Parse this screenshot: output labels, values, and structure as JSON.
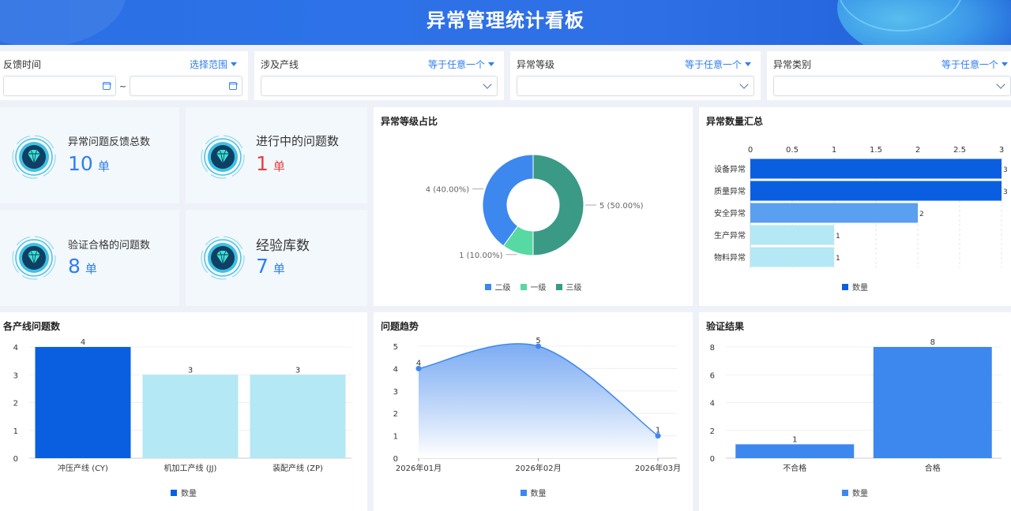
{
  "header": {
    "title": "异常管理统计看板"
  },
  "filters": {
    "feedback_time": {
      "label": "反馈时间",
      "op": "选择范围",
      "sep": "~"
    },
    "line": {
      "label": "涉及产线",
      "op": "等于任意一个"
    },
    "level": {
      "label": "异常等级",
      "op": "等于任意一个"
    },
    "category": {
      "label": "异常类别",
      "op": "等于任意一个"
    }
  },
  "kpis": [
    {
      "label": "异常问题反馈总数",
      "value": "10",
      "unit": "单"
    },
    {
      "label": "进行中的问题数",
      "value": "1",
      "unit": "单"
    },
    {
      "label": "验证合格的问题数",
      "value": "8",
      "unit": "单"
    },
    {
      "label": "经验库数",
      "value": "7",
      "unit": "单"
    }
  ],
  "colors": {
    "primary": "#2f7ef0",
    "red": "#e54141",
    "dark_blue": "#0a5fe0",
    "light_cyan": "#b3e8f4",
    "mid_blue": "#5a9ff0",
    "teal": "#3a9a86",
    "green": "#57d9a3",
    "blue": "#3d88ef"
  },
  "chart_data": [
    {
      "type": "pie",
      "title": "异常等级占比",
      "categories": [
        "二级",
        "一级",
        "三级"
      ],
      "values": [
        4,
        1,
        5
      ],
      "labels": [
        "4 (40.00%)",
        "1 (10.00%)",
        "5 (50.00%)"
      ],
      "colors": [
        "#3d88ef",
        "#57d9a3",
        "#3a9a86"
      ],
      "legend": "bottom"
    },
    {
      "type": "bar",
      "orientation": "horizontal",
      "title": "异常数量汇总",
      "categories": [
        "设备异常",
        "质量异常",
        "安全异常",
        "生产异常",
        "物料异常"
      ],
      "series": [
        {
          "name": "数量",
          "values": [
            3,
            3,
            2,
            1,
            1
          ]
        }
      ],
      "colors": [
        "#0a5fe0",
        "#0a5fe0",
        "#5a9ff0",
        "#b3e8f4",
        "#b3e8f4"
      ],
      "xlim": [
        0,
        3
      ],
      "xticks": [
        "0",
        "0.5",
        "1",
        "1.5",
        "2",
        "2.5",
        "3"
      ],
      "legend": "bottom"
    },
    {
      "type": "bar",
      "title": "各产线问题数",
      "categories": [
        "冲压产线 (CY)",
        "机加工产线 (JJ)",
        "装配产线 (ZP)"
      ],
      "series": [
        {
          "name": "数量",
          "values": [
            4,
            3,
            3
          ]
        }
      ],
      "colors": [
        "#0a5fe0",
        "#b3e8f4",
        "#b3e8f4"
      ],
      "ylim": [
        0,
        4
      ],
      "yticks": [
        "0",
        "1",
        "2",
        "3",
        "4"
      ],
      "legend": "bottom"
    },
    {
      "type": "area",
      "title": "问题趋势",
      "categories": [
        "2026年01月",
        "2026年02月",
        "2026年03月"
      ],
      "series": [
        {
          "name": "数量",
          "values": [
            4,
            5,
            1
          ]
        }
      ],
      "ylim": [
        0,
        5
      ],
      "yticks": [
        "0",
        "1",
        "2",
        "3",
        "4",
        "5"
      ],
      "legend": "bottom"
    },
    {
      "type": "bar",
      "title": "验证结果",
      "categories": [
        "不合格",
        "合格"
      ],
      "series": [
        {
          "name": "数量",
          "values": [
            1,
            8
          ]
        }
      ],
      "colors": [
        "#3d88ef",
        "#3d88ef"
      ],
      "ylim": [
        0,
        8
      ],
      "yticks": [
        "0",
        "2",
        "4",
        "6",
        "8"
      ],
      "legend": "bottom"
    }
  ]
}
